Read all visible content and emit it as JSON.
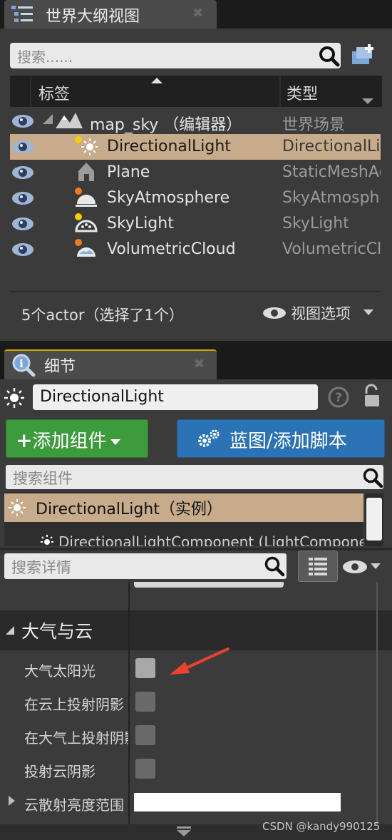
{
  "outliner": {
    "tab_title": "世界大纲视图",
    "search_placeholder": "搜索......",
    "col_label": "标签",
    "col_type": "类型",
    "rows": [
      {
        "label": "map_sky （编辑器）",
        "type": "世界场景",
        "icon": "world-icon"
      },
      {
        "label": "DirectionalLight",
        "type": "DirectionalLight",
        "icon": "directional-light-icon",
        "selected": true
      },
      {
        "label": "Plane",
        "type": "StaticMeshActor",
        "icon": "static-mesh-icon"
      },
      {
        "label": "SkyAtmosphere",
        "type": "SkyAtmosphere",
        "icon": "sky-atmosphere-icon"
      },
      {
        "label": "SkyLight",
        "type": "SkyLight",
        "icon": "sky-light-icon"
      },
      {
        "label": "VolumetricCloud",
        "type": "VolumetricCloud",
        "icon": "volumetric-cloud-icon"
      }
    ],
    "footer_count": "5个actor（选择了1个）",
    "view_options": "视图选项"
  },
  "details": {
    "tab_title": "细节",
    "actor_name": "DirectionalLight",
    "add_component": "添加组件",
    "blueprint": "蓝图/添加脚本",
    "component_search_placeholder": "搜索组件",
    "component_root": "DirectionalLight（实例）",
    "component_child": "DirectionalLightComponent (LightComponent)",
    "detail_search_placeholder": "搜索详情",
    "category": "大气与云",
    "props": [
      {
        "label": "大气太阳光",
        "checked": false,
        "highlighted": true
      },
      {
        "label": "在云上投射阴影",
        "checked": false
      },
      {
        "label": "在大气上投射阴影",
        "checked": false
      },
      {
        "label": "投射云阴影",
        "checked": false
      }
    ],
    "expand_prop": "云散射亮度范围"
  },
  "watermark": "CSDN @kandy990125",
  "colors": {
    "selection": "#c7ab8a",
    "add_button": "#3d9a3d",
    "blueprint_button": "#2b73b5",
    "annotation_arrow": "#e8432f"
  }
}
